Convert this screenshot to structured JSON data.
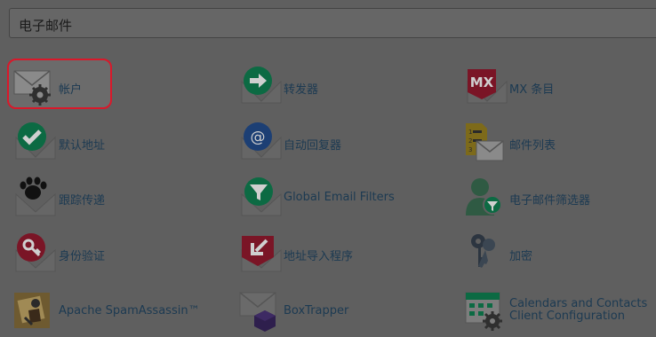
{
  "header": {
    "title": "电子邮件"
  },
  "items": [
    {
      "label": "帐户",
      "icon": "envelope-gear-icon"
    },
    {
      "label": "转发器",
      "icon": "forward-arrow-icon"
    },
    {
      "label": "MX 条目",
      "icon": "mx-record-icon",
      "badge": "MX"
    },
    {
      "label": "默认地址",
      "icon": "default-address-check-icon"
    },
    {
      "label": "自动回复器",
      "icon": "autoresponder-at-icon"
    },
    {
      "label": "邮件列表",
      "icon": "mailing-list-icon"
    },
    {
      "label": "跟踪传递",
      "icon": "paw-track-icon"
    },
    {
      "label": "Global Email Filters",
      "icon": "global-filter-funnel-icon"
    },
    {
      "label": "电子邮件筛选器",
      "icon": "user-filter-icon"
    },
    {
      "label": "身份验证",
      "icon": "key-auth-icon"
    },
    {
      "label": "地址导入程序",
      "icon": "import-arrow-icon"
    },
    {
      "label": "加密",
      "icon": "keys-encryption-icon"
    },
    {
      "label": "Apache SpamAssassin™",
      "icon": "spamassassin-icon"
    },
    {
      "label": "BoxTrapper",
      "icon": "boxtrapper-cube-icon"
    },
    {
      "label": "Calendars and Contacts Client Configuration",
      "label_line1": "Calendars and Contacts",
      "label_line2": "Client Configuration",
      "icon": "calendar-gear-icon"
    }
  ],
  "colors": {
    "background": "#5f5f5f",
    "link": "#1c3a52",
    "selected_border": "#d9182a",
    "green": "#0c6a43",
    "blue": "#1c3f74",
    "red": "#7a1526",
    "gold": "#7d6a1a"
  }
}
